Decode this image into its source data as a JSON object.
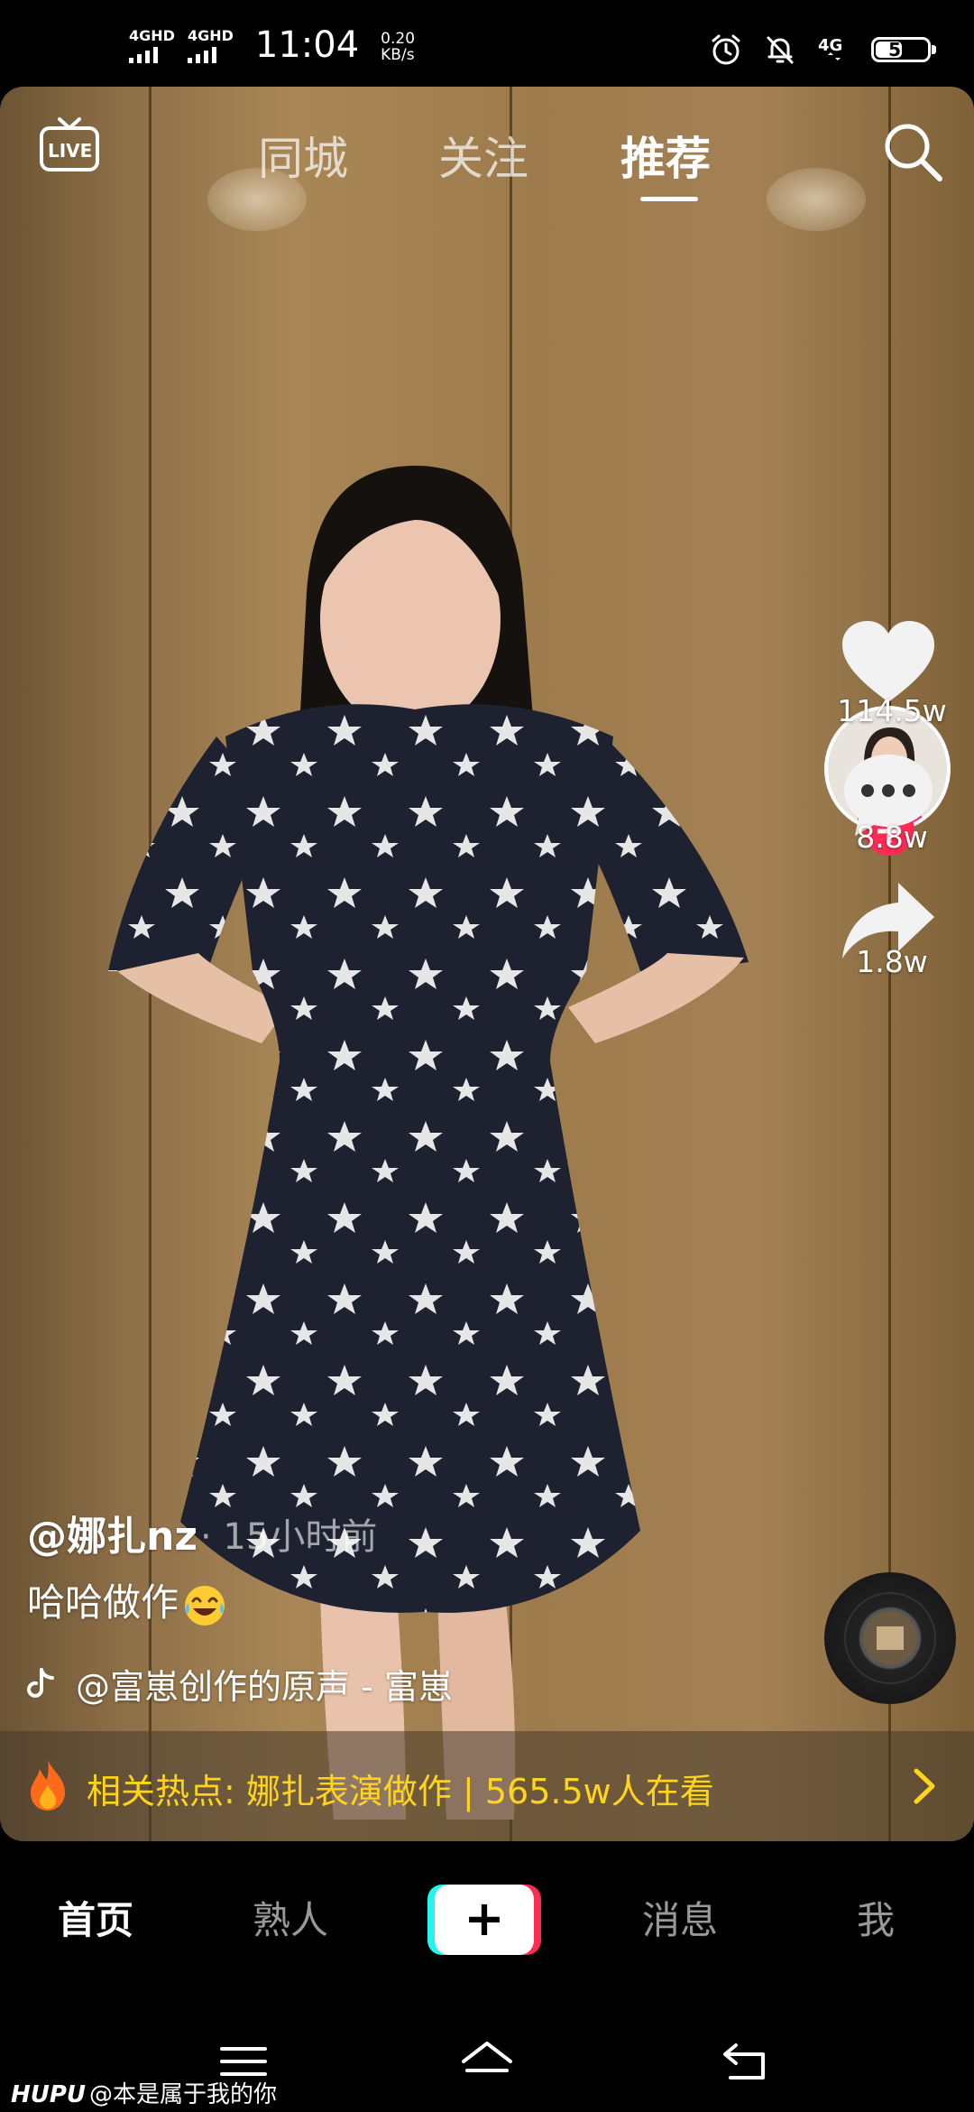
{
  "status_bar": {
    "signal1_label": "4GHD",
    "signal2_label": "4GHD",
    "time": "11:04",
    "net_speed_value": "0.20",
    "net_speed_unit": "KB/s",
    "network_type": "4G",
    "battery_level": "50",
    "icons": [
      "alarm-icon",
      "mute-bell-icon",
      "network-4g-icon",
      "battery-icon"
    ]
  },
  "top_bar": {
    "tabs": [
      {
        "label": "同城",
        "active": false
      },
      {
        "label": "关注",
        "active": false
      },
      {
        "label": "推荐",
        "active": true
      }
    ],
    "left_icon": "live-icon",
    "right_icon": "search-icon"
  },
  "video": {
    "author": "@娜扎nz",
    "time_ago": "· 15小时前",
    "description": "哈哈做作",
    "description_emoji": "laughing-tears-emoji",
    "music": "@富崽创作的原声 - 富崽"
  },
  "actions": {
    "likes": "114.5w",
    "comments": "8.8w",
    "shares": "1.8w",
    "follow_symbol": "+"
  },
  "hot_topic": {
    "text": "相关热点: 娜扎表演做作 | 565.5w人在看",
    "accent_color": "#ffd41a"
  },
  "bottom_nav": {
    "items": [
      {
        "label": "首页",
        "active": true
      },
      {
        "label": "熟人",
        "active": false
      },
      {
        "label": "消息",
        "active": false
      },
      {
        "label": "我",
        "active": false
      }
    ],
    "plus_symbol": "+"
  },
  "watermark": {
    "brand": "HUPU",
    "user": "@本是属于我的你"
  },
  "colors": {
    "follow_red": "#fe2c55",
    "cyan": "#25f4ee",
    "hot_yellow": "#ffd41a"
  }
}
